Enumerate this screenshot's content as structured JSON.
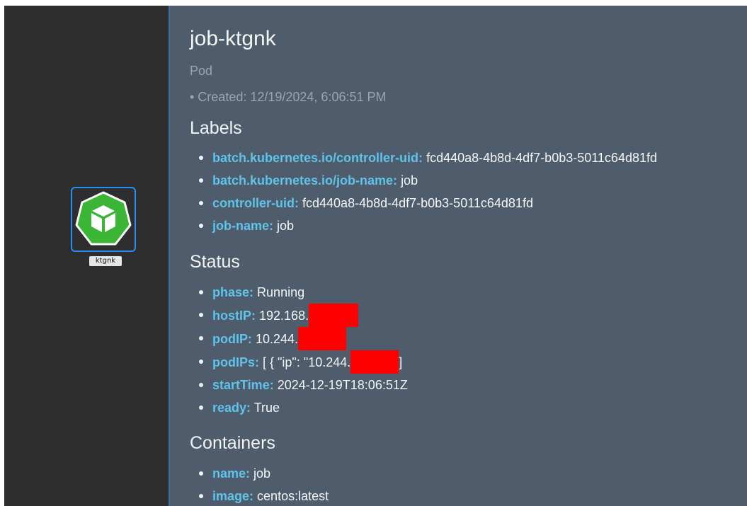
{
  "graph": {
    "node_label": "ktgnk",
    "node_icon": "kubernetes-pod-icon",
    "node_color": "#3ab535",
    "selection_color": "#2a8ff5"
  },
  "detail": {
    "title": "job-ktgnk",
    "kind": "Pod",
    "created": "• Created: 12/19/2024, 6:06:51 PM",
    "labels_heading": "Labels",
    "labels": [
      {
        "key": "batch.kubernetes.io/controller-uid:",
        "value": "fcd440a8-4b8d-4df7-b0b3-5011c64d81fd"
      },
      {
        "key": "batch.kubernetes.io/job-name:",
        "value": "job"
      },
      {
        "key": "controller-uid:",
        "value": "fcd440a8-4b8d-4df7-b0b3-5011c64d81fd"
      },
      {
        "key": "job-name:",
        "value": "job"
      }
    ],
    "status_heading": "Status",
    "status": {
      "phase_key": "phase:",
      "phase": "Running",
      "hostip_key": "hostIP:",
      "hostip": "192.168.",
      "podip_key": "podIP:",
      "podip": "10.244.",
      "podips_key": "podIPs:",
      "podips": "[ { \"ip\": \"10.244.",
      "podips_tail": "]",
      "starttime_key": "startTime:",
      "starttime": "2024-12-19T18:06:51Z",
      "ready_key": "ready:",
      "ready": "True"
    },
    "containers_heading": "Containers",
    "containers": [
      {
        "key": "name:",
        "value": "job"
      },
      {
        "key": "image:",
        "value": "centos:latest"
      }
    ]
  }
}
